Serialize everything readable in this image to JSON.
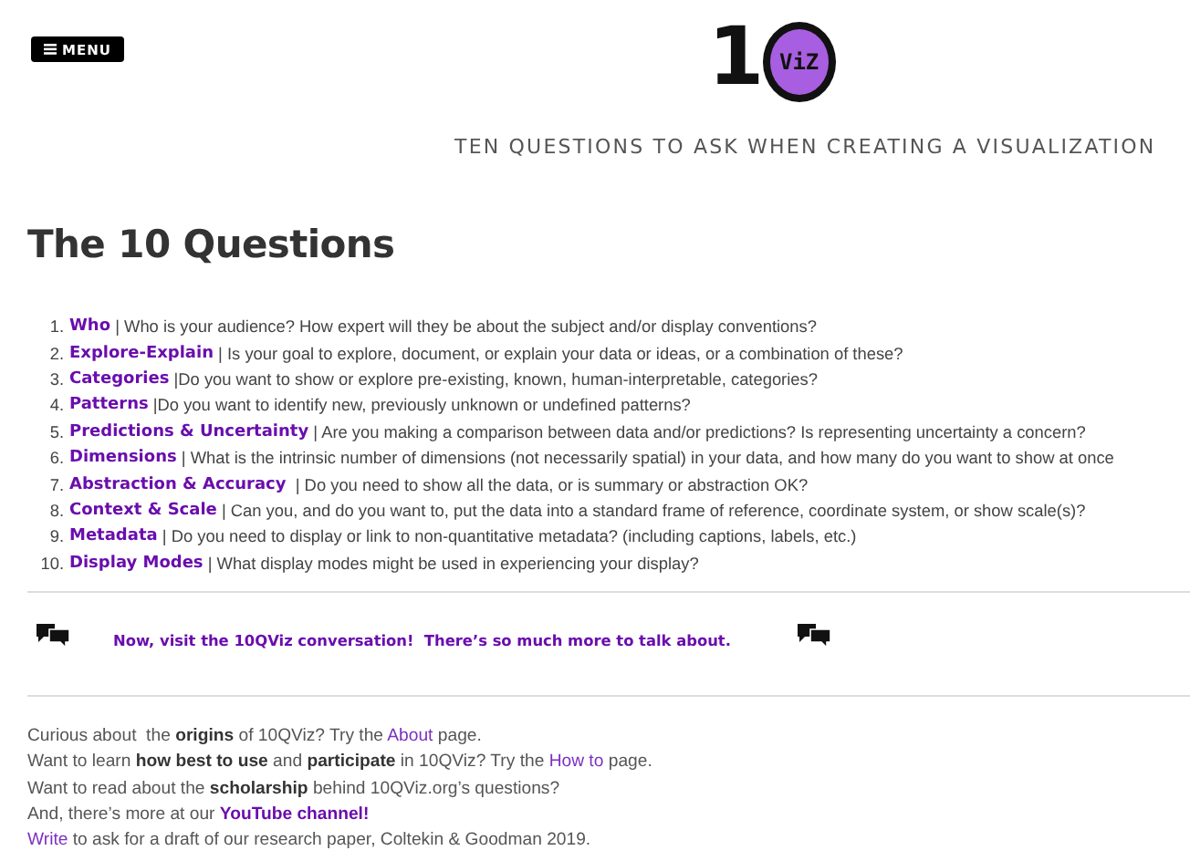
{
  "menu_button": {
    "label": "MENU"
  },
  "logo": {
    "digit": "1",
    "badge": "ViZ"
  },
  "tagline": "TEN QUESTIONS TO ASK WHEN CREATING A VISUALIZATION",
  "heading": "The 10 Questions",
  "questions": [
    {
      "number": "1.",
      "term": "Who",
      "text": " | Who is your audience? How expert will they be about the subject and/or display conventions?"
    },
    {
      "number": "2.",
      "term": "Explore-Explain",
      "text": " | Is your goal to explore, document, or explain your data or ideas, or a combination of these?"
    },
    {
      "number": "3.",
      "term": "Categories",
      "text": " |Do you want to show or explore pre-existing, known, human-interpretable, categories?"
    },
    {
      "number": "4.",
      "term": "Patterns",
      "text": " |Do you want to identify new, previously unknown or undefined patterns?"
    },
    {
      "number": "5.",
      "term": "Predictions & Uncertainty",
      "text": " | Are you making a comparison between data and/or predictions? Is representing uncertainty a concern?"
    },
    {
      "number": "6.",
      "term": "Dimensions",
      "text": " | What is the intrinsic number of dimensions (not necessarily spatial) in your data, and how many do you want to show at once"
    },
    {
      "number": "7.",
      "term": "Abstraction & Accuracy",
      "text": "  | Do you need to show all the data, or is summary or abstraction OK?"
    },
    {
      "number": "8.",
      "term": "Context & Scale",
      "text": " | Can you, and do you want to, put the data into a standard frame of reference, coordinate system, or show scale(s)?"
    },
    {
      "number": "9.",
      "term": "Metadata",
      "text": " | Do you need to display or link to non-quantitative metadata? (including captions, labels, etc.)"
    },
    {
      "number": "10.",
      "term": "Display Modes",
      "text": " | What display modes might be used in experiencing your display?"
    }
  ],
  "conversation": {
    "text": "Now, visit the 10QViz conversation!  There’s so much more to talk about."
  },
  "footer_lines": [
    [
      {
        "kind": "plain",
        "text": "Curious about  the "
      },
      {
        "kind": "bold",
        "text": "origins"
      },
      {
        "kind": "plain",
        "text": " of 10QViz? Try the "
      },
      {
        "kind": "link",
        "text": "About"
      },
      {
        "kind": "plain",
        "text": " page."
      }
    ],
    [
      {
        "kind": "plain",
        "text": "Want to learn "
      },
      {
        "kind": "bold",
        "text": "how best to use"
      },
      {
        "kind": "plain",
        "text": " and "
      },
      {
        "kind": "bold",
        "text": "participate"
      },
      {
        "kind": "plain",
        "text": " in 10QViz? Try the "
      },
      {
        "kind": "link",
        "text": "How to"
      },
      {
        "kind": "plain",
        "text": " page."
      }
    ],
    [
      {
        "kind": "plain",
        "text": "Want to read about the "
      },
      {
        "kind": "bold",
        "text": "scholarship"
      },
      {
        "kind": "plain",
        "text": " behind 10QViz.org’s questions?"
      }
    ],
    [
      {
        "kind": "plain",
        "text": "And, there’s more at our "
      },
      {
        "kind": "boldlink",
        "text": "YouTube channel!"
      }
    ],
    [
      {
        "kind": "link",
        "text": "Write"
      },
      {
        "kind": "plain",
        "text": " to ask for a draft of our research paper, Coltekin & Goodman 2019."
      }
    ]
  ]
}
